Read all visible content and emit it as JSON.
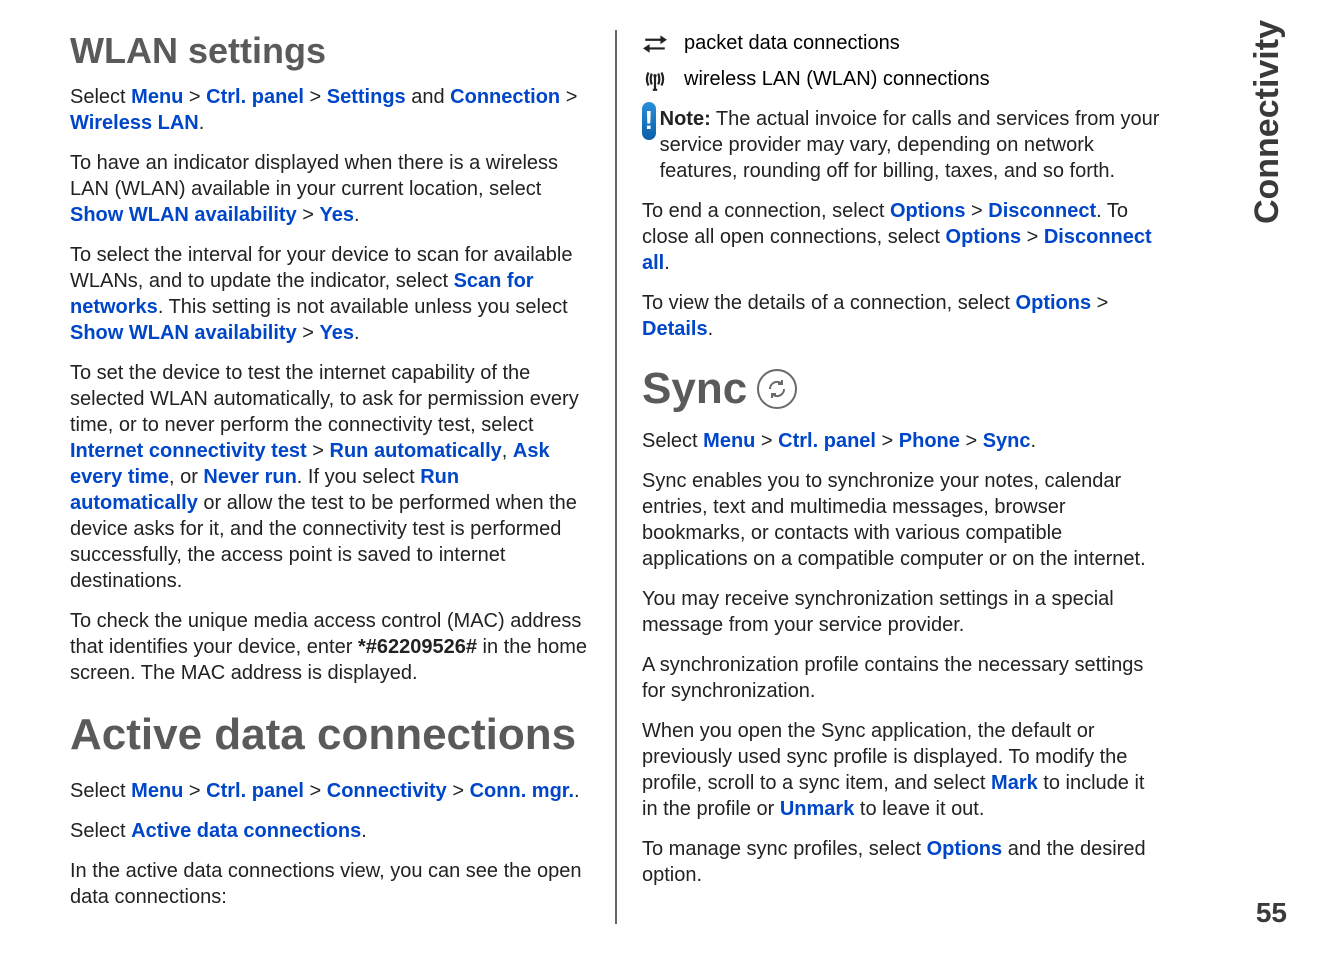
{
  "sideTab": "Connectivity",
  "pageNumber": "55",
  "left": {
    "heading1": "WLAN settings",
    "p1": {
      "t1": "Select ",
      "l1": "Menu",
      "t2": " > ",
      "l2": "Ctrl. panel",
      "t3": " > ",
      "l3": "Settings",
      "t4": " and ",
      "l4": "Connection",
      "t5": " > ",
      "l5": "Wireless LAN",
      "t6": "."
    },
    "p2": {
      "t1": "To have an indicator displayed when there is a wireless LAN (WLAN) available in your current location, select ",
      "l1": "Show WLAN availability",
      "t2": " > ",
      "l2": "Yes",
      "t3": "."
    },
    "p3": {
      "t1": "To select the interval for your device to scan for available WLANs, and to update the indicator, select ",
      "l1": "Scan for networks",
      "t2": ". This setting is not available unless you select ",
      "l2": "Show WLAN availability",
      "t3": " > ",
      "l3": "Yes",
      "t4": "."
    },
    "p4": {
      "t1": "To set the device to test the internet capability of the selected WLAN automatically, to ask for permission every time, or to never perform the connectivity test, select ",
      "l1": "Internet connectivity test",
      "t2": " > ",
      "l2": "Run automatically",
      "t3": ", ",
      "l3": "Ask every time",
      "t4": ", or ",
      "l4": "Never run",
      "t5": ". If you select ",
      "l5": "Run automatically",
      "t6": " or allow the test to be performed when the device asks for it, and the connectivity test is performed successfully, the access point is saved to internet destinations."
    },
    "p5": {
      "t1": "To check the unique media access control (MAC) address that identifies your device, enter ",
      "b1": "*#62209526#",
      "t2": " in the home screen. The MAC address is displayed."
    },
    "heading2": "Active data connections",
    "p6": {
      "t1": "Select ",
      "l1": "Menu",
      "t2": " > ",
      "l2": "Ctrl. panel",
      "t3": " > ",
      "l3": "Connectivity",
      "t4": " > ",
      "l4": "Conn. mgr.",
      "t5": "."
    },
    "p7": {
      "t1": "Select ",
      "l1": "Active data connections",
      "t2": "."
    },
    "p8": "In the active data connections view, you can see the open data connections:"
  },
  "right": {
    "row1": "packet data connections",
    "row2": "wireless LAN (WLAN) connections",
    "note": {
      "label": "Note:",
      "text": "  The actual invoice for calls and services from your service provider may vary, depending on network features, rounding off for billing, taxes, and so forth."
    },
    "p1": {
      "t1": "To end a connection, select ",
      "l1": "Options",
      "t2": " > ",
      "l2": "Disconnect",
      "t3": ". To close all open connections, select ",
      "l3": "Options",
      "t4": " > ",
      "l4": "Disconnect all",
      "t5": "."
    },
    "p2": {
      "t1": "To view the details of a connection, select ",
      "l1": "Options",
      "t2": " > ",
      "l2": "Details",
      "t3": "."
    },
    "syncHeading": "Sync",
    "p3": {
      "t1": "Select ",
      "l1": "Menu",
      "t2": " > ",
      "l2": "Ctrl. panel",
      "t3": " > ",
      "l3": "Phone",
      "t4": " > ",
      "l4": "Sync",
      "t5": "."
    },
    "p4": "Sync enables you to synchronize your notes, calendar entries, text and multimedia messages, browser bookmarks, or contacts with various compatible applications on a compatible computer or on the internet.",
    "p5": "You may receive synchronization settings in a special message from your service provider.",
    "p6": "A synchronization profile contains the necessary settings for synchronization.",
    "p7": {
      "t1": "When you open the Sync application, the default or previously used sync profile is displayed. To modify the profile, scroll to a sync item, and select ",
      "l1": "Mark",
      "t2": " to include it in the profile or ",
      "l2": "Unmark",
      "t3": " to leave it out."
    },
    "p8": {
      "t1": "To manage sync profiles, select ",
      "l1": "Options",
      "t2": " and the desired option."
    }
  }
}
